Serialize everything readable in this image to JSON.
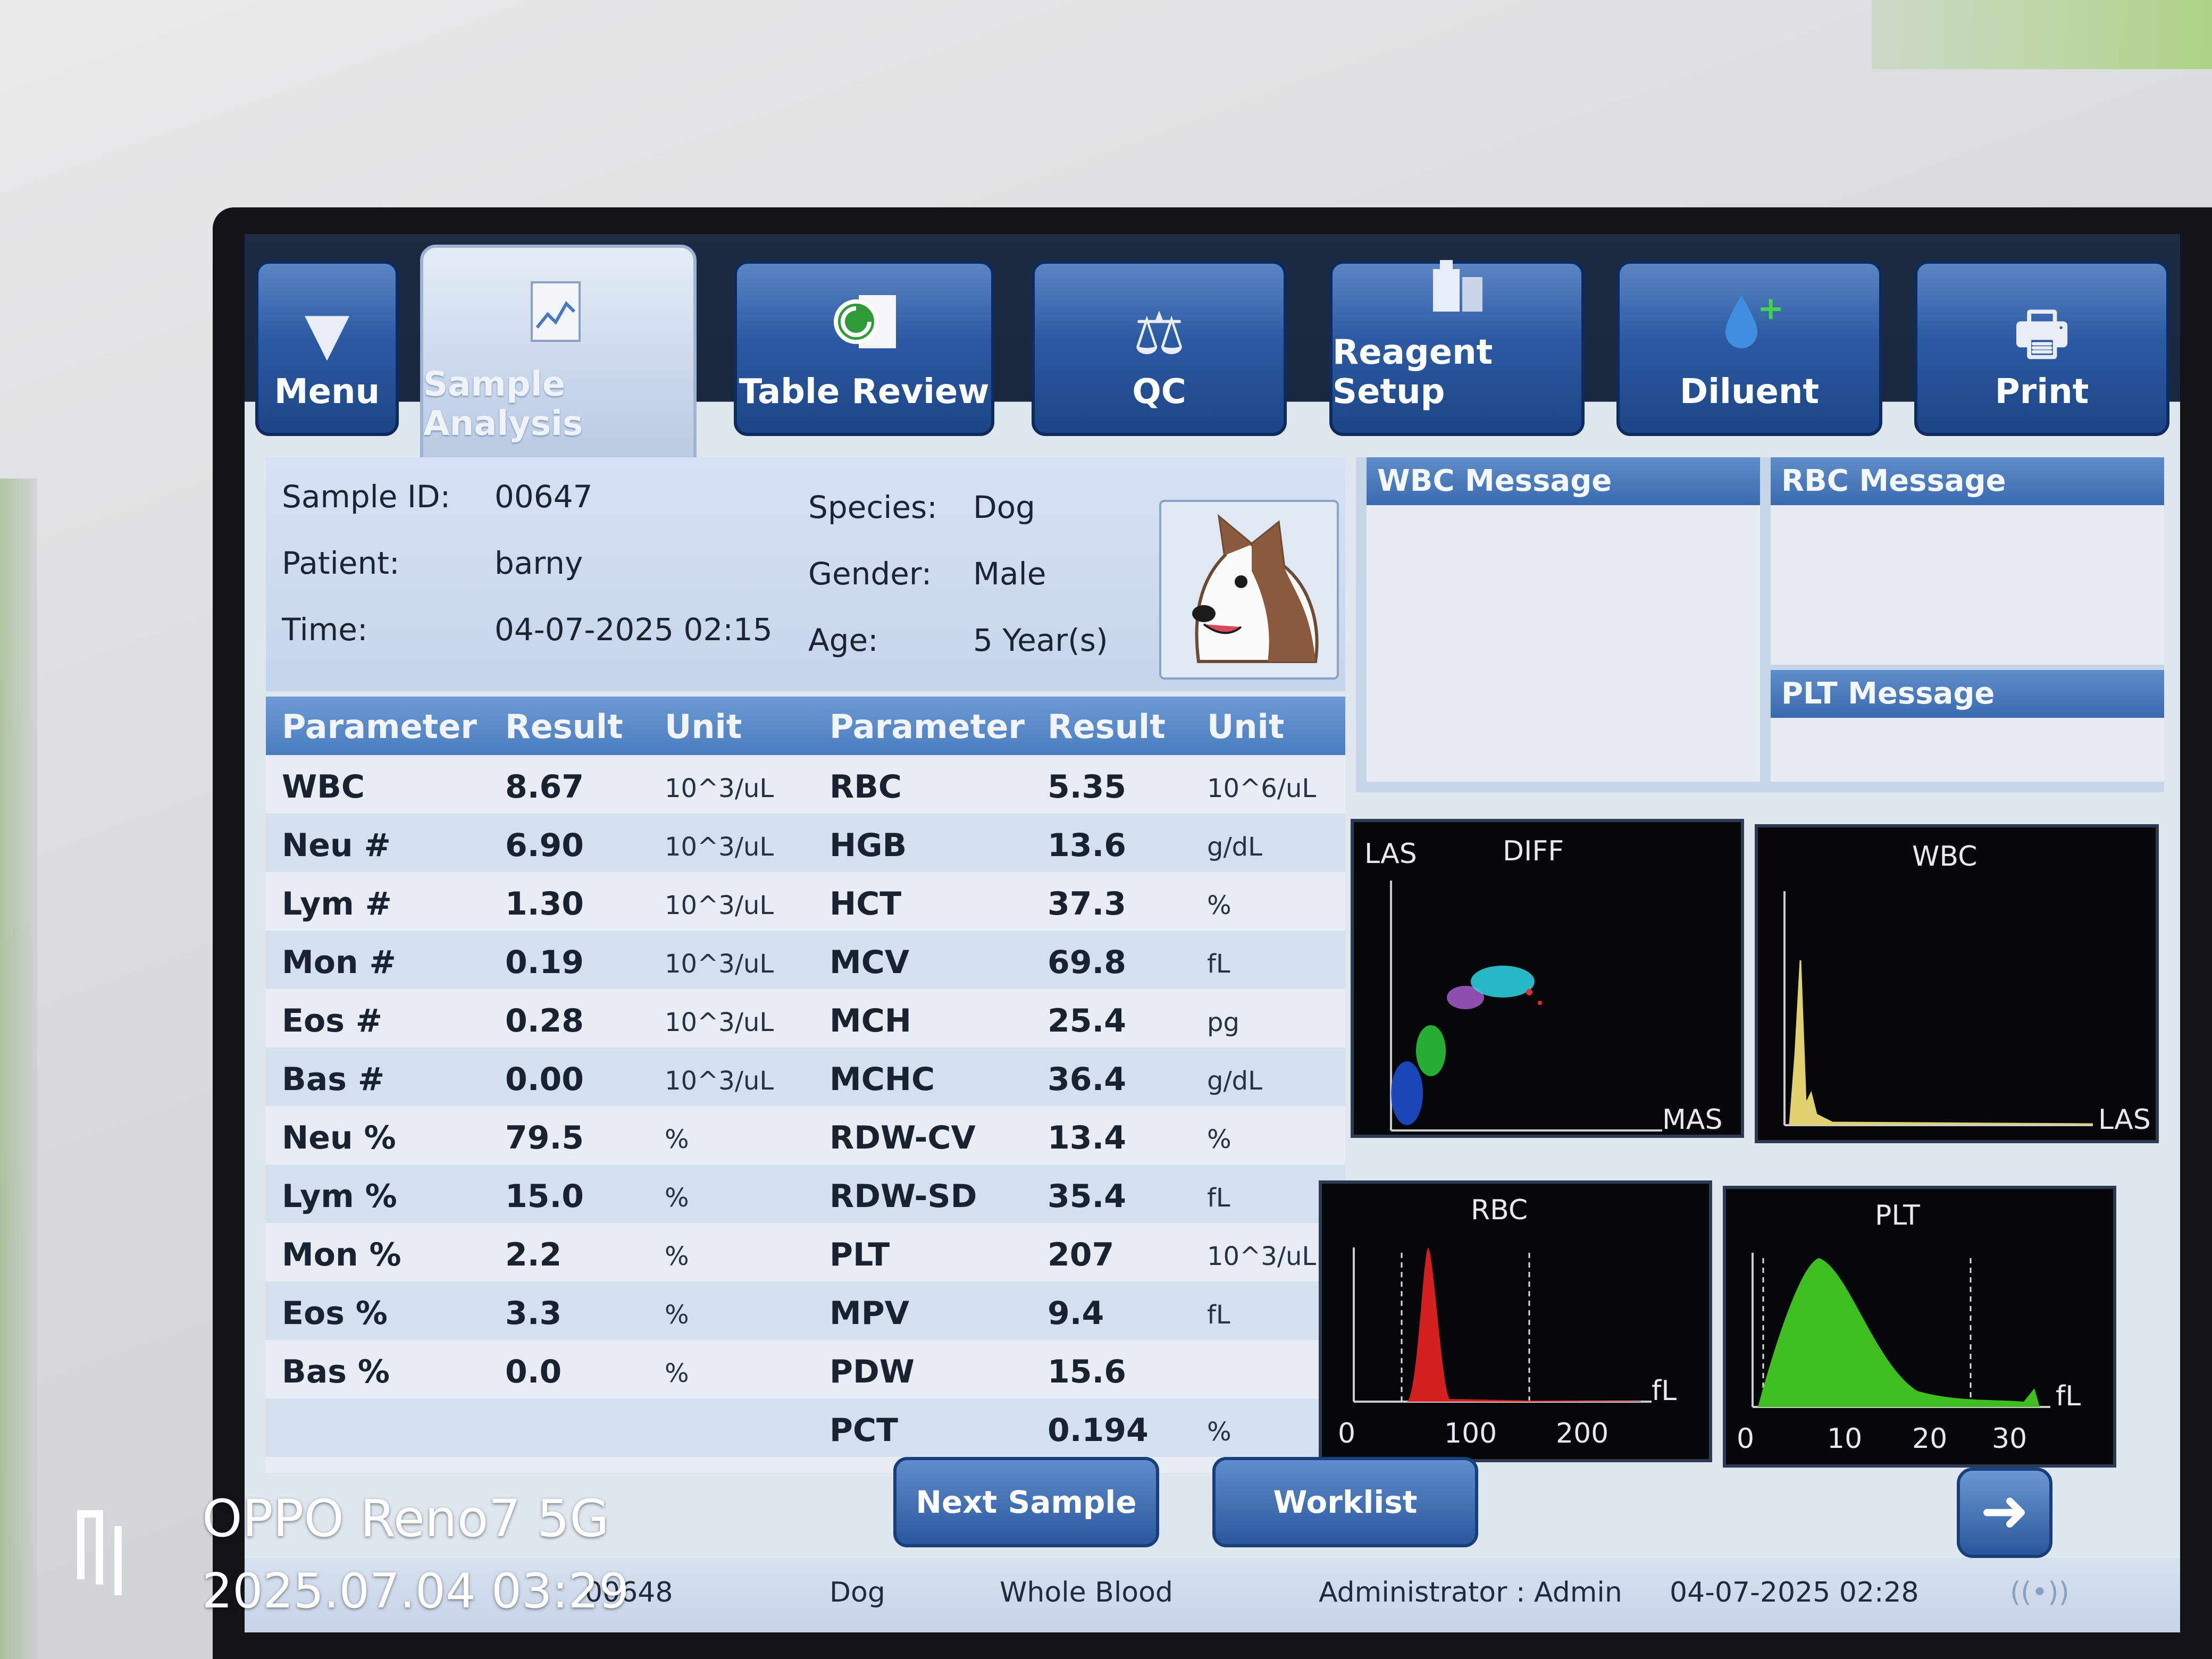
{
  "toolbar": {
    "menu": "Menu",
    "sample_analysis": "Sample Analysis",
    "table_review": "Table Review",
    "qc": "QC",
    "reagent_setup": "Reagent Setup",
    "diluent": "Diluent",
    "print": "Print"
  },
  "sample": {
    "id_label": "Sample ID:",
    "id": "00647",
    "patient_label": "Patient:",
    "patient": "barny",
    "time_label": "Time:",
    "time": "04-07-2025 02:15",
    "species_label": "Species:",
    "species": "Dog",
    "gender_label": "Gender:",
    "gender": "Male",
    "age_label": "Age:",
    "age": "5 Year(s)"
  },
  "messages": {
    "wbc": "WBC Message",
    "rbc": "RBC Message",
    "plt": "PLT Message"
  },
  "table": {
    "headers": [
      "Parameter",
      "Result",
      "Unit",
      "Parameter",
      "Result",
      "Unit"
    ],
    "left": [
      {
        "p": "WBC",
        "r": "8.67",
        "u": "10^3/uL"
      },
      {
        "p": "Neu #",
        "r": "6.90",
        "u": "10^3/uL"
      },
      {
        "p": "Lym #",
        "r": "1.30",
        "u": "10^3/uL"
      },
      {
        "p": "Mon #",
        "r": "0.19",
        "u": "10^3/uL"
      },
      {
        "p": "Eos #",
        "r": "0.28",
        "u": "10^3/uL"
      },
      {
        "p": "Bas #",
        "r": "0.00",
        "u": "10^3/uL"
      },
      {
        "p": "Neu %",
        "r": "79.5",
        "u": "%"
      },
      {
        "p": "Lym %",
        "r": "15.0",
        "u": "%"
      },
      {
        "p": "Mon %",
        "r": "2.2",
        "u": "%"
      },
      {
        "p": "Eos %",
        "r": "3.3",
        "u": "%"
      },
      {
        "p": "Bas %",
        "r": "0.0",
        "u": "%"
      }
    ],
    "right": [
      {
        "p": "RBC",
        "r": "5.35",
        "u": "10^6/uL"
      },
      {
        "p": "HGB",
        "r": "13.6",
        "u": "g/dL"
      },
      {
        "p": "HCT",
        "r": "37.3",
        "u": "%"
      },
      {
        "p": "MCV",
        "r": "69.8",
        "u": "fL"
      },
      {
        "p": "MCH",
        "r": "25.4",
        "u": "pg"
      },
      {
        "p": "MCHC",
        "r": "36.4",
        "u": "g/dL"
      },
      {
        "p": "RDW-CV",
        "r": "13.4",
        "u": "%"
      },
      {
        "p": "RDW-SD",
        "r": "35.4",
        "u": "fL"
      },
      {
        "p": "PLT",
        "r": "207",
        "u": "10^3/uL"
      },
      {
        "p": "MPV",
        "r": "9.4",
        "u": "fL"
      },
      {
        "p": "PDW",
        "r": "15.6",
        "u": ""
      },
      {
        "p": "PCT",
        "r": "0.194",
        "u": "%"
      }
    ]
  },
  "graphs": {
    "diff": {
      "title": "DIFF",
      "y": "LAS",
      "x": "MAS"
    },
    "wbc": {
      "title": "WBC",
      "x": "LAS"
    },
    "rbc": {
      "title": "RBC",
      "unit": "fL",
      "ticks": [
        "0",
        "100",
        "200"
      ]
    },
    "plt": {
      "title": "PLT",
      "unit": "fL",
      "ticks": [
        "0",
        "10",
        "20",
        "30"
      ]
    }
  },
  "buttons": {
    "next_sample": "Next Sample",
    "worklist": "Worklist"
  },
  "status": {
    "next_id": "00648",
    "species": "Dog",
    "mode": "Whole Blood",
    "user": "Administrator : Admin",
    "datetime": "04-07-2025 02:28"
  },
  "watermark": {
    "brand": "OPPO Reno7 5G",
    "date": "2025.07.04 03:29"
  },
  "colors": {
    "toolbar_blue": "#2c5aa1",
    "header_blue": "#4a7cc0",
    "rbc_curve": "#d42020",
    "plt_curve": "#3fbf1f",
    "wbc_curve": "#e0d070"
  }
}
